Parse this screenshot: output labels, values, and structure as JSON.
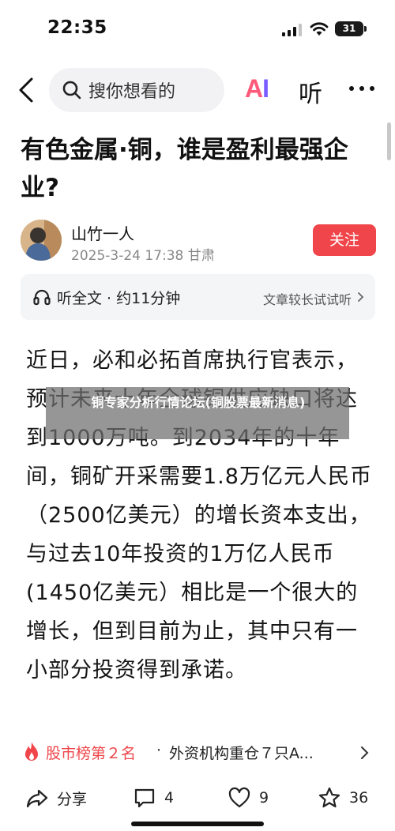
{
  "status_bar": {
    "time": "22:35",
    "battery": "31"
  },
  "nav": {
    "search_placeholder": "搜你想看的",
    "ai_label_a": "A",
    "ai_label_i": "I",
    "listen_label": "听"
  },
  "article": {
    "title": "有色金属·铜，谁是盈利最强企业?",
    "author": {
      "name": "山竹一人",
      "meta": "2025-3-24 17:38 甘肃",
      "follow_label": "关注"
    },
    "listen_bar": {
      "label": "听全文 · 约11分钟",
      "hint": "文章较长试试听"
    },
    "body": "近日，必和必拓首席执行官表示，预计未来十年全球铜供应缺口将达到1000万吨。到2034年的十年间，铜矿开采需要1.8万亿元人民币（2500亿美元）的增长资本支出，与过去10年投资的1万亿人民币(1450亿美元）相比是一个很大的增长，但到目前为止，其中只有一小部分投资得到承诺。"
  },
  "overlay": {
    "text": "铜专家分析行情论坛(铜股票最新消息)"
  },
  "hot_rank": {
    "rank_label": "股市榜第２名",
    "separator": "·",
    "news": "外资机构重仓７只A..."
  },
  "actions": {
    "share_label": "分享",
    "comment_count": "4",
    "like_count": "9",
    "star_count": "36"
  },
  "colors": {
    "accent_red": "#f0454a",
    "ai_pink": "#ff5a7a",
    "ai_purple": "#7a5cff"
  },
  "icons": [
    "back-icon",
    "search-icon",
    "more-icon",
    "headphone-icon",
    "chevron-right-icon",
    "fire-icon",
    "share-icon",
    "comment-icon",
    "heart-icon",
    "star-icon"
  ]
}
